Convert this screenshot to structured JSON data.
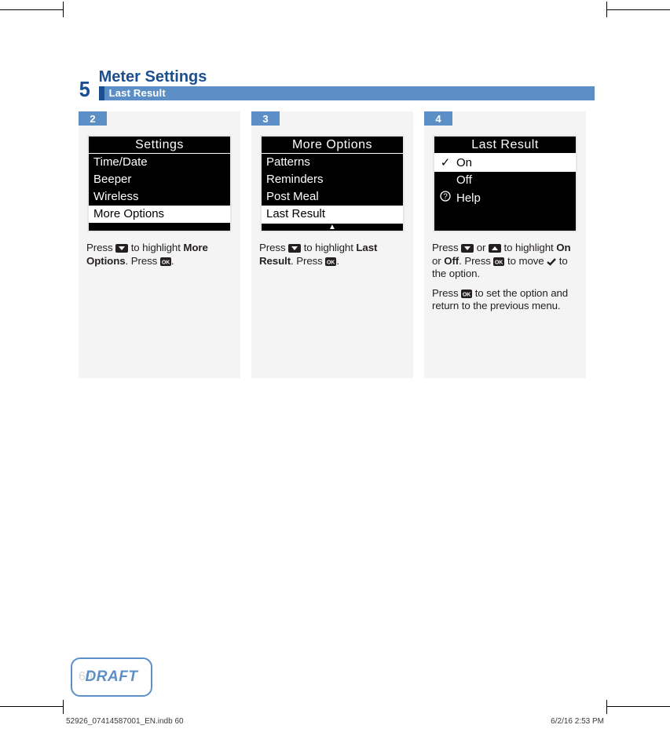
{
  "chapter": {
    "number": "5",
    "title": "Meter Settings",
    "subtitle": "Last Result"
  },
  "steps": [
    {
      "num": "2",
      "screen": {
        "title": "Settings",
        "rows": [
          {
            "text": "Time/Date",
            "lead": "",
            "sel": false
          },
          {
            "text": "Beeper",
            "lead": "",
            "sel": false
          },
          {
            "text": "Wireless",
            "lead": "",
            "sel": false
          },
          {
            "text": "More Options",
            "lead": "",
            "sel": true
          }
        ],
        "show_scroll_arrows": false
      },
      "instruction_parts": {
        "p1": "Press ",
        "p2": " to highlight ",
        "bold1": "More Options",
        "p3": ". Press ",
        "p4": "."
      }
    },
    {
      "num": "3",
      "screen": {
        "title": "More Options",
        "rows": [
          {
            "text": "Patterns",
            "lead": "",
            "sel": false
          },
          {
            "text": "Reminders",
            "lead": "",
            "sel": false
          },
          {
            "text": "Post Meal",
            "lead": "",
            "sel": false
          },
          {
            "text": "Last Result",
            "lead": "",
            "sel": true,
            "dashed": true
          }
        ],
        "show_scroll_arrows": true
      },
      "instruction_parts": {
        "p1": "Press ",
        "p2": " to highlight ",
        "bold1": "Last Result",
        "p3": ". Press ",
        "p4": "."
      }
    },
    {
      "num": "4",
      "screen": {
        "title": "Last Result",
        "rows": [
          {
            "text": "On",
            "lead": "✓",
            "sel": true
          },
          {
            "text": "Off",
            "lead": "",
            "sel": false
          },
          {
            "text": "Help",
            "lead": "?",
            "sel": false
          }
        ],
        "show_scroll_arrows": false
      },
      "instruction_parts": {
        "p1": "Press ",
        "p2": " or ",
        "p3": " to highlight ",
        "bold1": "On",
        "p4": " or ",
        "bold2": "Off",
        "p5": ". Press ",
        "p6": " to move ",
        "p7": " to the option.",
        "para2_a": "Press ",
        "para2_b": " to set the option and return to the previous menu."
      }
    }
  ],
  "draft": {
    "bg_page_num": "60",
    "label": "DRAFT"
  },
  "footer": {
    "left_a": "52926_07414587001_EN.indb   60",
    "right_a": "6/2/16   2:53 PM"
  }
}
